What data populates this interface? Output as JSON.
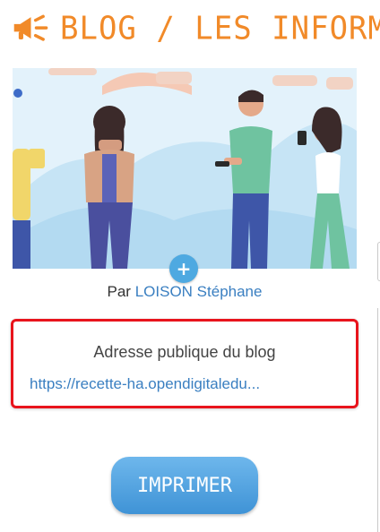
{
  "header": {
    "title": "BLOG / LES INFORMATI",
    "icon": "megaphone-icon",
    "color": "#f18a29"
  },
  "cover": {
    "add_icon": "plus-icon",
    "add_label": "+"
  },
  "author": {
    "prefix": "Par",
    "name": "LOISON Stéphane"
  },
  "public_address": {
    "title": "Adresse publique du blog",
    "url": "https://recette-ha.opendigitaledu..."
  },
  "print_button": {
    "label": "IMPRIMER"
  }
}
